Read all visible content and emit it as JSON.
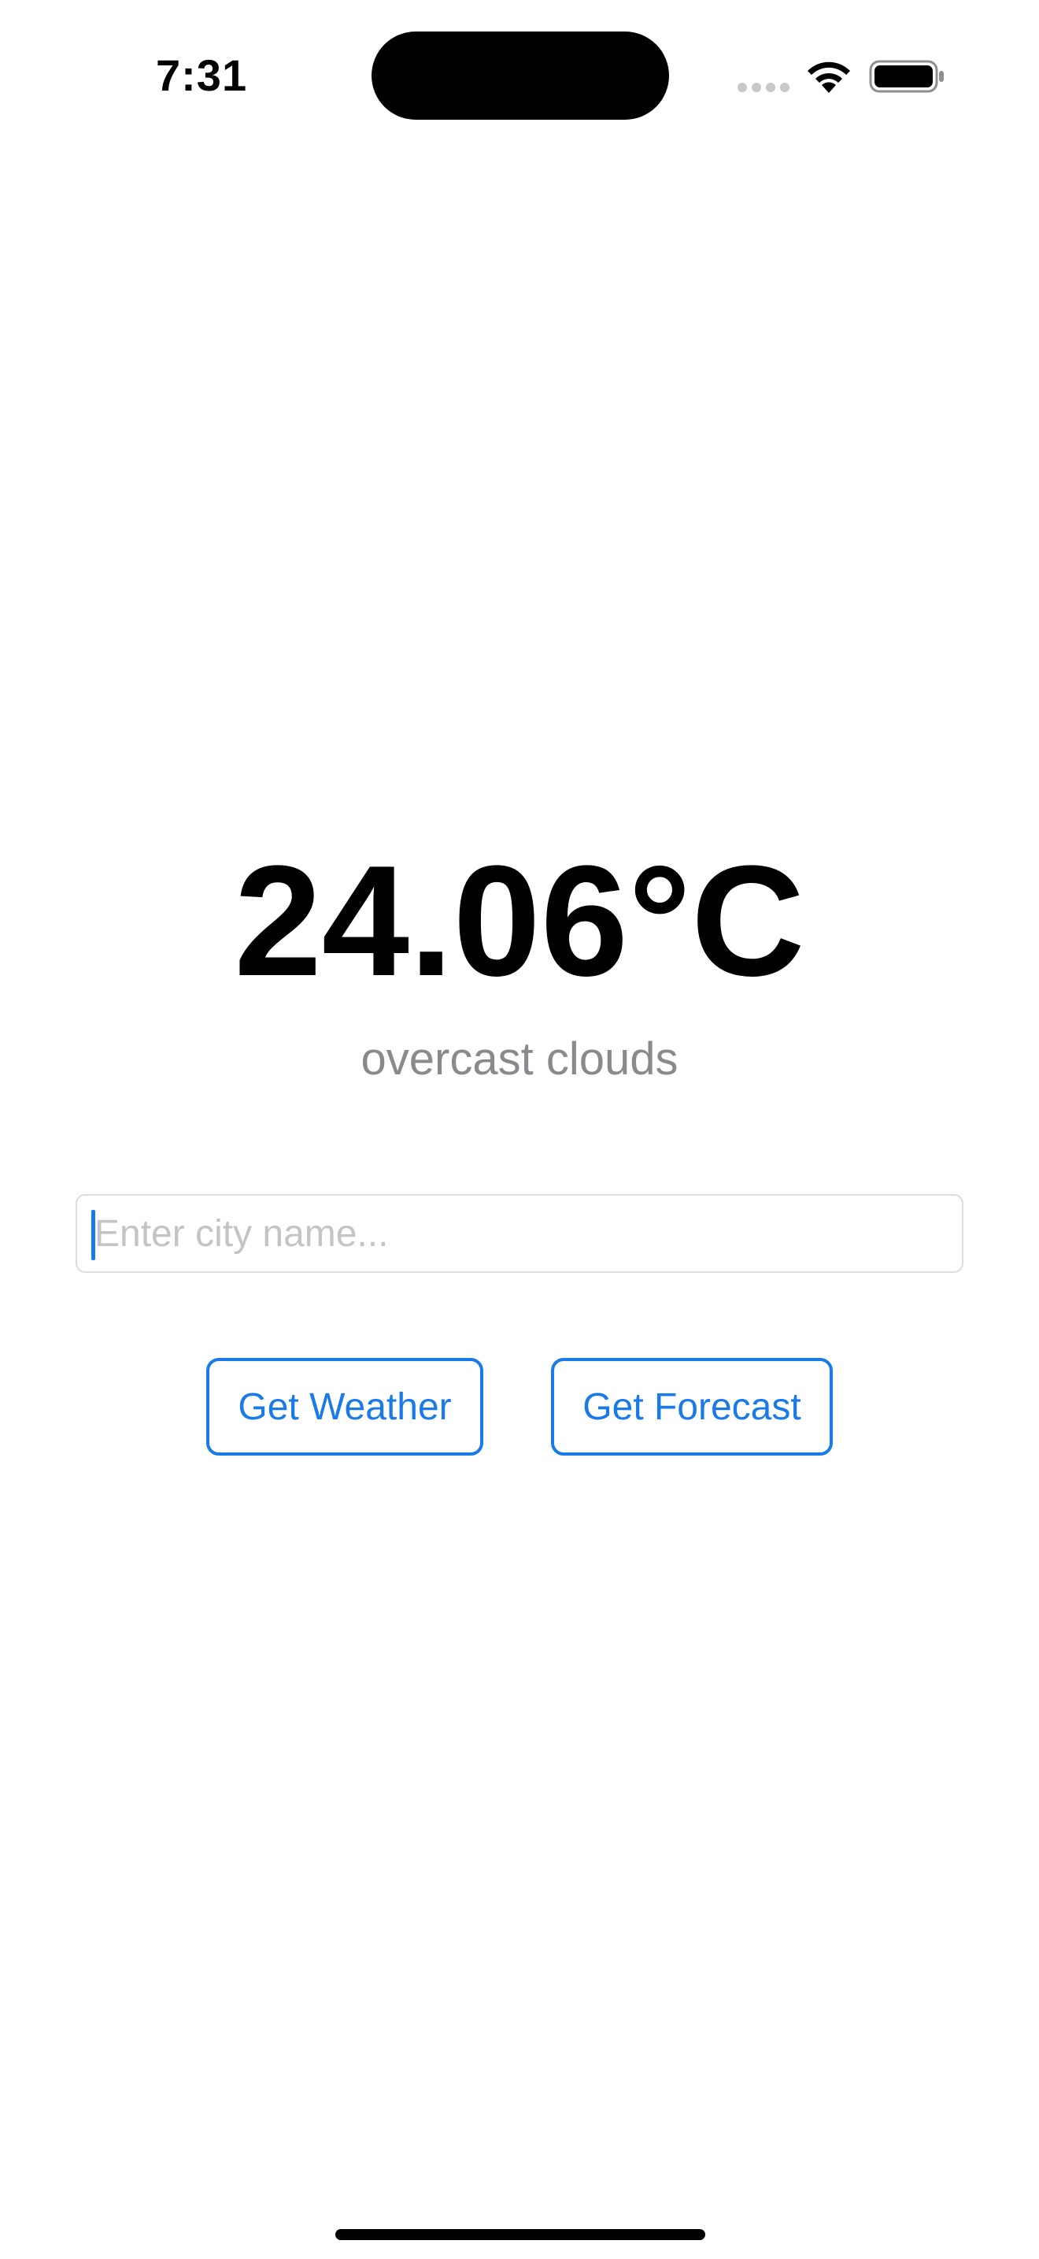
{
  "status_bar": {
    "time": "7:31"
  },
  "weather": {
    "temperature": "24.06°C",
    "description": "overcast clouds"
  },
  "search": {
    "placeholder": "Enter city name...",
    "value": ""
  },
  "buttons": {
    "get_weather": "Get Weather",
    "get_forecast": "Get Forecast"
  },
  "colors": {
    "accent": "#1a7ae8",
    "secondary_text": "#8a8a8e"
  },
  "icons": [
    "cellular-signal-icon",
    "wifi-icon",
    "battery-icon"
  ]
}
